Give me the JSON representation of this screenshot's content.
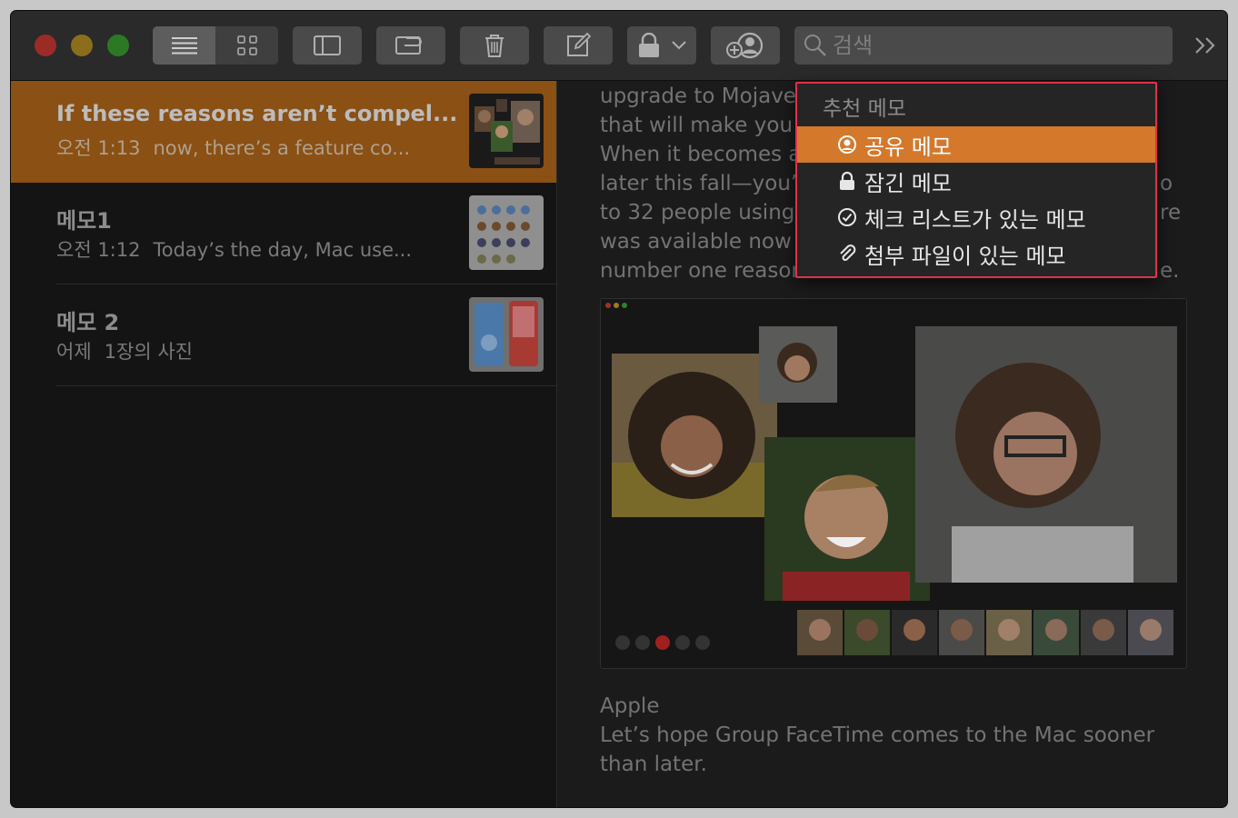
{
  "toolbar": {
    "window_controls": [
      "close",
      "minimize",
      "zoom"
    ],
    "view_modes": [
      "list-view",
      "gallery-view"
    ],
    "buttons": [
      "sidebar-toggle",
      "attachments",
      "delete",
      "compose",
      "lock",
      "add-people"
    ],
    "search_placeholder": "검색",
    "more_icon": ">>"
  },
  "notes": [
    {
      "title": "If these reasons aren’t compel...",
      "time": "오전 1:13",
      "preview": "now, there’s a feature co...",
      "selected": true
    },
    {
      "title": "메모1",
      "time": "오전 1:12",
      "preview": "Today’s the day, Mac use...",
      "selected": false
    },
    {
      "title": "메모 2",
      "time": "어제",
      "preview": "1장의 사진",
      "selected": false
    }
  ],
  "editor": {
    "lines": [
      "upgrade to Mojave",
      "that will make you",
      "When it becomes a",
      "later this fall—you’",
      "to 32 people using",
      "was available now",
      "number one reason"
    ],
    "right_fragments": [
      "o",
      "re",
      "e."
    ],
    "caption": "Apple",
    "footer_lines": [
      "Let’s hope Group FaceTime comes to the Mac sooner",
      "than later."
    ]
  },
  "suggestions_menu": {
    "header": "추천 메모",
    "items": [
      {
        "label": "공유 메모",
        "icon": "person-circle-icon",
        "highlighted": true
      },
      {
        "label": "잠긴 메모",
        "icon": "lock-icon",
        "highlighted": false
      },
      {
        "label": "체크 리스트가 있는 메모",
        "icon": "checkmark-circle-icon",
        "highlighted": false
      },
      {
        "label": "첨부 파일이 있는 메모",
        "icon": "paperclip-icon",
        "highlighted": false
      }
    ],
    "highlight_color": "#d4782c",
    "outline_color": "#e2304a"
  },
  "colors": {
    "close": "#9b2b27",
    "minimize": "#8c6d1c",
    "zoom": "#2b7a23",
    "selection": "#8a5014"
  }
}
